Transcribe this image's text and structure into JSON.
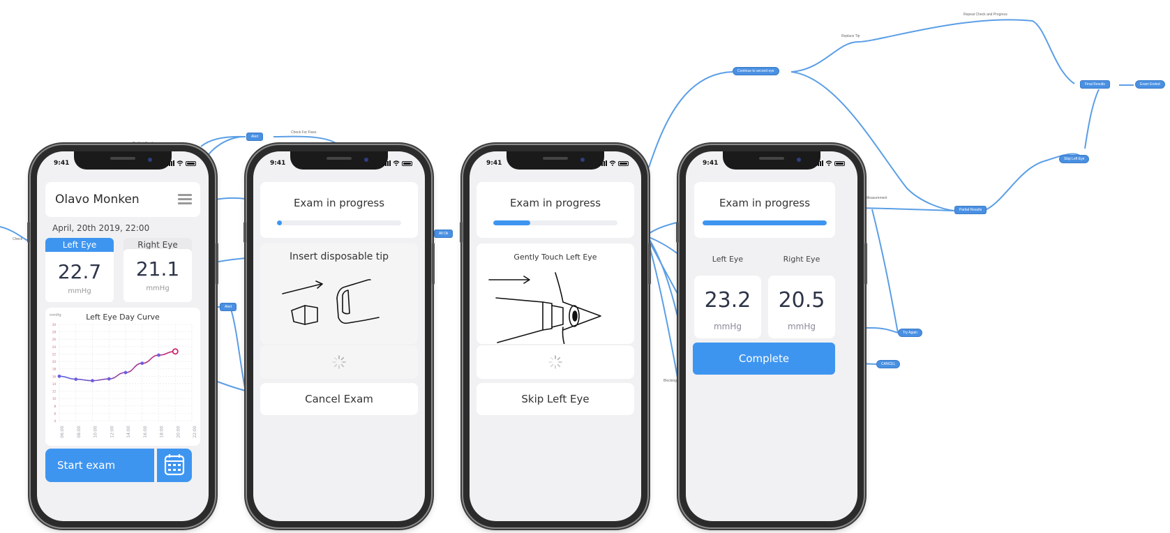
{
  "status_time": "9:41",
  "flow": {
    "nodes": {
      "alert_top": "Alert",
      "alert_mid": "Alert",
      "all_ok": "All Ok",
      "continue_second_eye": "Continue to second eye",
      "final_results": "Final Results",
      "exam_ended": "Exam Ended",
      "skip_left_eye": "Skip Left Eye",
      "partial_results": "Partial Results",
      "try_again": "Try Again",
      "cancel": "CANCEL"
    },
    "edge_labels": {
      "tip_not_gently": "Tip Not Gently",
      "check_for_fixes": "Check For Fixes",
      "check": "Check",
      "replace_tip": "Replace Tip",
      "repeat_check_progress": "Repeat Check and Progress",
      "measurement": "Measurement",
      "blocking": "Blocking"
    }
  },
  "phone1": {
    "user_name": "Olavo Monken",
    "datetime": "April, 20th 2019, 22:00",
    "tab_left": "Left Eye",
    "tab_right": "Right Eye",
    "left_value": "22.7",
    "right_value": "21.1",
    "unit": "mmHg",
    "chart_title": "Left Eye Day Curve",
    "chart_unit": "mmHg",
    "start_button": "Start exam",
    "calendar_icon": "calendar-icon"
  },
  "phone2": {
    "header": "Exam in progress",
    "progress": 0.04,
    "instruction": "Insert disposable tip",
    "action_button": "Cancel Exam"
  },
  "phone3": {
    "header": "Exam in progress",
    "progress": 0.3,
    "instruction": "Gently Touch Left Eye",
    "action_button": "Skip Left Eye"
  },
  "phone4": {
    "header": "Exam in progress",
    "progress": 1.0,
    "left_label": "Left Eye",
    "right_label": "Right Eye",
    "left_value": "23.2",
    "right_value": "20.5",
    "unit": "mmHg",
    "complete_button": "Complete"
  },
  "chart_data": {
    "type": "line",
    "title": "Left Eye Day Curve",
    "ylabel": "mmHg",
    "x": [
      "06:00",
      "08:00",
      "10:00",
      "12:00",
      "14:00",
      "16:00",
      "18:00",
      "20:00",
      "22:00"
    ],
    "y_ticks": [
      "30",
      "28",
      "26",
      "24",
      "22",
      "20",
      "18",
      "16",
      "14",
      "12",
      "10",
      "8",
      "6",
      "4"
    ],
    "series": [
      {
        "values": [
          16,
          15.2,
          14.8,
          15.3,
          17,
          19.5,
          21.7,
          22.7,
          null
        ]
      }
    ],
    "ylim": [
      4,
      30
    ],
    "grid": true,
    "highlight_last_point": true
  }
}
